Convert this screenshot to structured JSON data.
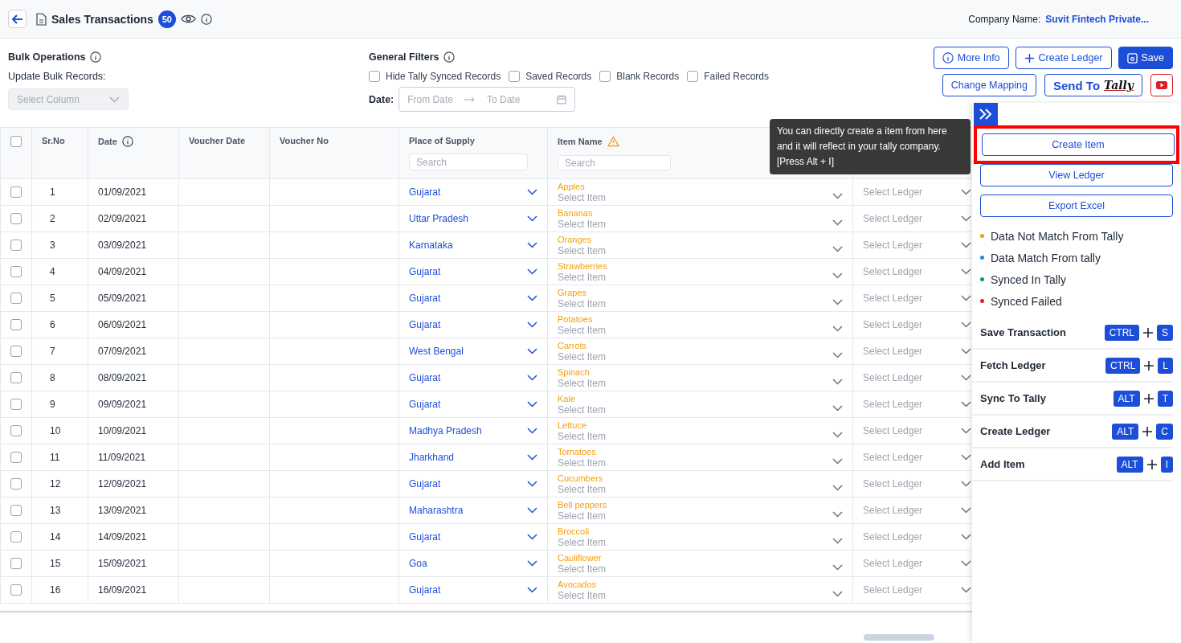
{
  "header": {
    "title": "Sales Transactions",
    "count": "50",
    "company_label": "Company Name:",
    "company_name": "Suvit Fintech Private..."
  },
  "bulk": {
    "title": "Bulk Operations",
    "subtitle": "Update Bulk Records:",
    "select": {
      "placeholder": "Select Column",
      "disabled": true
    }
  },
  "filters": {
    "title": "General Filters",
    "options": [
      {
        "label": "Hide Tally Synced Records",
        "checked": false
      },
      {
        "label": "Saved Records",
        "checked": false
      },
      {
        "label": "Blank Records",
        "checked": false
      },
      {
        "label": "Failed Records",
        "checked": false
      }
    ],
    "date_label": "Date:",
    "from_placeholder": "From Date",
    "to_placeholder": "To Date"
  },
  "actions": {
    "more_info": "More Info",
    "create_ledger": "Create Ledger",
    "save": "Save",
    "change_mapping": "Change Mapping",
    "send_to": "Send To",
    "tally_logo": "Tally"
  },
  "table": {
    "select_all_checked": false,
    "columns": [
      {
        "kind": "check"
      },
      {
        "kind": "plain",
        "label": "Sr.No"
      },
      {
        "kind": "info",
        "label": "Date"
      },
      {
        "kind": "plain",
        "label": "Voucher Date"
      },
      {
        "kind": "plain",
        "label": "Voucher No"
      },
      {
        "kind": "search",
        "label": "Place of Supply",
        "placeholder": "Search"
      },
      {
        "kind": "warn",
        "label": "Item Name",
        "placeholder": "Search"
      },
      {
        "kind": "covered"
      }
    ],
    "rows": [
      {
        "checked": false,
        "sr": "1",
        "date": "01/09/2021",
        "place": "Gujarat",
        "item": "Apples",
        "item_placeholder": "Select Item",
        "ledger_placeholder": "Select Ledger"
      },
      {
        "checked": false,
        "sr": "2",
        "date": "02/09/2021",
        "place": "Uttar Pradesh",
        "item": "Bananas",
        "item_placeholder": "Select Item",
        "ledger_placeholder": "Select Ledger"
      },
      {
        "checked": false,
        "sr": "3",
        "date": "03/09/2021",
        "place": "Karnataka",
        "item": "Oranges",
        "item_placeholder": "Select Item",
        "ledger_placeholder": "Select Ledger"
      },
      {
        "checked": false,
        "sr": "4",
        "date": "04/09/2021",
        "place": "Gujarat",
        "item": "Strawberries",
        "item_placeholder": "Select Item",
        "ledger_placeholder": "Select Ledger"
      },
      {
        "checked": false,
        "sr": "5",
        "date": "05/09/2021",
        "place": "Gujarat",
        "item": "Grapes",
        "item_placeholder": "Select Item",
        "ledger_placeholder": "Select Ledger"
      },
      {
        "checked": false,
        "sr": "6",
        "date": "06/09/2021",
        "place": "Gujarat",
        "item": "Potatoes",
        "item_placeholder": "Select Item",
        "ledger_placeholder": "Select Ledger"
      },
      {
        "checked": false,
        "sr": "7",
        "date": "07/09/2021",
        "place": "West Bengal",
        "item": "Carrots",
        "item_placeholder": "Select Item",
        "ledger_placeholder": "Select Ledger"
      },
      {
        "checked": false,
        "sr": "8",
        "date": "08/09/2021",
        "place": "Gujarat",
        "item": "Spinach",
        "item_placeholder": "Select Item",
        "ledger_placeholder": "Select Ledger"
      },
      {
        "checked": false,
        "sr": "9",
        "date": "09/09/2021",
        "place": "Gujarat",
        "item": "Kale",
        "item_placeholder": "Select Item",
        "ledger_placeholder": "Select Ledger"
      },
      {
        "checked": false,
        "sr": "10",
        "date": "10/09/2021",
        "place": "Madhya Pradesh",
        "item": "Lettuce",
        "item_placeholder": "Select Item",
        "ledger_placeholder": "Select Ledger"
      },
      {
        "checked": false,
        "sr": "11",
        "date": "11/09/2021",
        "place": "Jharkhand",
        "item": "Tomatoes",
        "item_placeholder": "Select Item",
        "ledger_placeholder": "Select Ledger"
      },
      {
        "checked": false,
        "sr": "12",
        "date": "12/09/2021",
        "place": "Gujarat",
        "item": "Cucumbers",
        "item_placeholder": "Select Item",
        "ledger_placeholder": "Select Ledger"
      },
      {
        "checked": false,
        "sr": "13",
        "date": "13/09/2021",
        "place": "Maharashtra",
        "item": "Bell peppers",
        "item_placeholder": "Select Item",
        "ledger_placeholder": "Select Ledger"
      },
      {
        "checked": false,
        "sr": "14",
        "date": "14/09/2021",
        "place": "Gujarat",
        "item": "Broccoli",
        "item_placeholder": "Select Item",
        "ledger_placeholder": "Select Ledger"
      },
      {
        "checked": false,
        "sr": "15",
        "date": "15/09/2021",
        "place": "Goa",
        "item": "Cauliflower",
        "item_placeholder": "Select Item",
        "ledger_placeholder": "Select Ledger"
      },
      {
        "checked": false,
        "sr": "16",
        "date": "16/09/2021",
        "place": "Gujarat",
        "item": "Avocados",
        "item_placeholder": "Select Item",
        "ledger_placeholder": "Select Ledger"
      }
    ]
  },
  "tooltip": {
    "text": "You can directly create a item from here and it will reflect in your tally company. [Press Alt + I]"
  },
  "panel": {
    "expanded": true,
    "buttons": [
      {
        "label": "Create Item",
        "highlighted": true
      },
      {
        "label": "View Ledger",
        "highlighted": false
      },
      {
        "label": "Export Excel",
        "highlighted": false
      }
    ],
    "legend": [
      {
        "label": "Data Not Match From Tally",
        "color": "#f59e0b"
      },
      {
        "label": "Data Match From tally",
        "color": "#1e88e5"
      },
      {
        "label": "Synced In Tally",
        "color": "#0f9d58"
      },
      {
        "label": "Synced Failed",
        "color": "#e11d2a"
      }
    ],
    "shortcuts": [
      {
        "label": "Save Transaction",
        "modifier": "CTRL",
        "key": "S"
      },
      {
        "label": "Fetch Ledger",
        "modifier": "CTRL",
        "key": "L"
      },
      {
        "label": "Sync To Tally",
        "modifier": "ALT",
        "key": "T"
      },
      {
        "label": "Create Ledger",
        "modifier": "ALT",
        "key": "C"
      },
      {
        "label": "Add Item",
        "modifier": "ALT",
        "key": "I"
      }
    ]
  }
}
